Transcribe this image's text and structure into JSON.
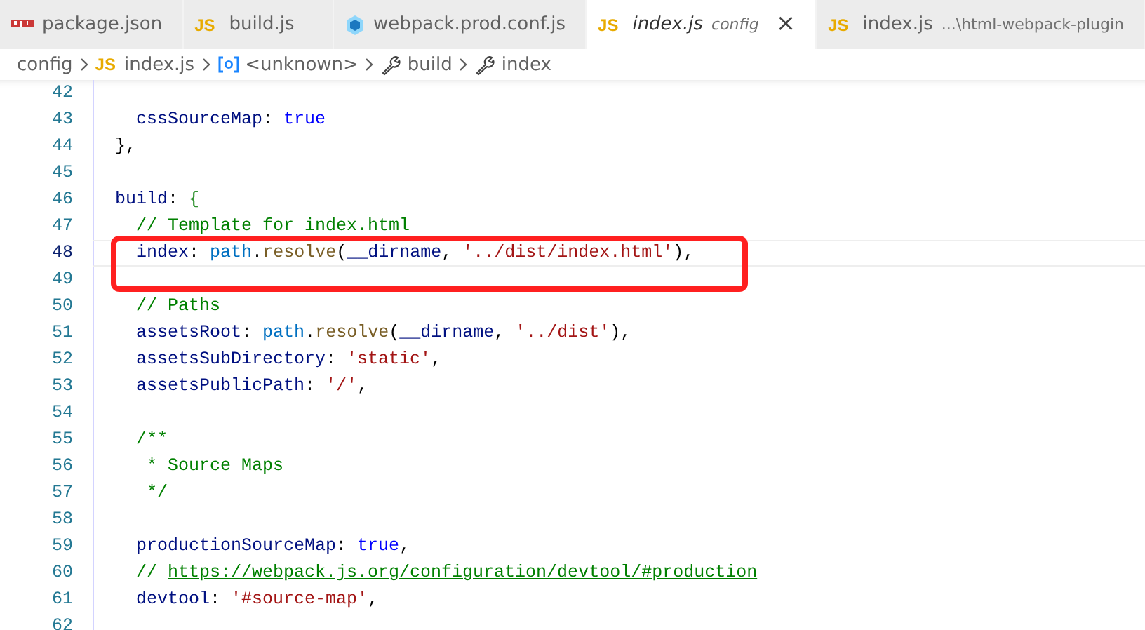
{
  "tabs": [
    {
      "kind": "npm",
      "label": "package.json",
      "selected": false
    },
    {
      "kind": "js",
      "icon_text": "JS",
      "label": "build.js",
      "selected": false
    },
    {
      "kind": "webpack",
      "label": "webpack.prod.conf.js",
      "selected": false
    },
    {
      "kind": "js",
      "icon_text": "JS",
      "label": "index.js",
      "description": "config",
      "close": "×",
      "selected": true
    },
    {
      "kind": "js",
      "icon_text": "JS",
      "label": "index.js",
      "description": "...\\html-webpack-plugin",
      "selected": false
    }
  ],
  "breadcrumbs": [
    {
      "label": "config"
    },
    {
      "kind": "js",
      "icon_text": "JS",
      "label": "index.js"
    },
    {
      "kind": "symbol",
      "label": "<unknown>"
    },
    {
      "kind": "wrench",
      "label": "build"
    },
    {
      "kind": "wrench",
      "label": "index"
    }
  ],
  "editor": {
    "lines": [
      {
        "number": "42",
        "current": false,
        "highlighted": false
      },
      {
        "number": "43",
        "current": false,
        "highlighted": false,
        "tokens": [
          {
            "kind": "prop",
            "text": "    cssSourceMap"
          },
          {
            "kind": "punct",
            "text": ": "
          },
          {
            "kind": "keyword",
            "text": "true"
          }
        ]
      },
      {
        "number": "44",
        "current": false,
        "highlighted": false,
        "tokens": [
          {
            "kind": "punct",
            "text": "  },"
          }
        ]
      },
      {
        "number": "45",
        "current": false,
        "highlighted": false
      },
      {
        "number": "46",
        "current": false,
        "highlighted": false,
        "tokens": [
          {
            "kind": "prop",
            "text": "  build"
          },
          {
            "kind": "punct",
            "text": ": "
          },
          {
            "kind": "bracket",
            "text": "{"
          }
        ]
      },
      {
        "number": "47",
        "current": false,
        "highlighted": false,
        "tokens": [
          {
            "kind": "comment",
            "text": "    // Template for index.html"
          }
        ]
      },
      {
        "number": "48",
        "current": true,
        "highlighted": true,
        "tokens": [
          {
            "kind": "prop",
            "text": "    index"
          },
          {
            "kind": "punct",
            "text": ": "
          },
          {
            "kind": "var",
            "text": "path"
          },
          {
            "kind": "punct",
            "text": "."
          },
          {
            "kind": "func",
            "text": "resolve"
          },
          {
            "kind": "punct",
            "text": "("
          },
          {
            "kind": "prop",
            "text": "__dirname"
          },
          {
            "kind": "punct",
            "text": ", "
          },
          {
            "kind": "string",
            "text": "'../dist/index.html'"
          },
          {
            "kind": "punct",
            "text": "),"
          }
        ]
      },
      {
        "number": "49",
        "current": false,
        "highlighted": false
      },
      {
        "number": "50",
        "current": false,
        "highlighted": false,
        "tokens": [
          {
            "kind": "comment",
            "text": "    // Paths"
          }
        ]
      },
      {
        "number": "51",
        "current": false,
        "highlighted": false,
        "tokens": [
          {
            "kind": "prop",
            "text": "    assetsRoot"
          },
          {
            "kind": "punct",
            "text": ": "
          },
          {
            "kind": "var",
            "text": "path"
          },
          {
            "kind": "punct",
            "text": "."
          },
          {
            "kind": "func",
            "text": "resolve"
          },
          {
            "kind": "punct",
            "text": "("
          },
          {
            "kind": "prop",
            "text": "__dirname"
          },
          {
            "kind": "punct",
            "text": ", "
          },
          {
            "kind": "string",
            "text": "'../dist'"
          },
          {
            "kind": "punct",
            "text": "),"
          }
        ]
      },
      {
        "number": "52",
        "current": false,
        "highlighted": false,
        "tokens": [
          {
            "kind": "prop",
            "text": "    assetsSubDirectory"
          },
          {
            "kind": "punct",
            "text": ": "
          },
          {
            "kind": "string",
            "text": "'static'"
          },
          {
            "kind": "punct",
            "text": ","
          }
        ]
      },
      {
        "number": "53",
        "current": false,
        "highlighted": false,
        "tokens": [
          {
            "kind": "prop",
            "text": "    assetsPublicPath"
          },
          {
            "kind": "punct",
            "text": ": "
          },
          {
            "kind": "string",
            "text": "'/'"
          },
          {
            "kind": "punct",
            "text": ","
          }
        ]
      },
      {
        "number": "54",
        "current": false,
        "highlighted": false
      },
      {
        "number": "55",
        "current": false,
        "highlighted": false,
        "tokens": [
          {
            "kind": "comment",
            "text": "    /**"
          }
        ]
      },
      {
        "number": "56",
        "current": false,
        "highlighted": false,
        "tokens": [
          {
            "kind": "comment",
            "text": "     * Source Maps"
          }
        ]
      },
      {
        "number": "57",
        "current": false,
        "highlighted": false,
        "tokens": [
          {
            "kind": "comment",
            "text": "     */"
          }
        ]
      },
      {
        "number": "58",
        "current": false,
        "highlighted": false
      },
      {
        "number": "59",
        "current": false,
        "highlighted": false,
        "tokens": [
          {
            "kind": "prop",
            "text": "    productionSourceMap"
          },
          {
            "kind": "punct",
            "text": ": "
          },
          {
            "kind": "keyword",
            "text": "true"
          },
          {
            "kind": "punct",
            "text": ","
          }
        ]
      },
      {
        "number": "60",
        "current": false,
        "highlighted": false,
        "tokens": [
          {
            "kind": "comment",
            "text": "    // "
          },
          {
            "kind": "link",
            "text": "https://webpack.js.org/configuration/devtool/#production"
          }
        ]
      },
      {
        "number": "61",
        "current": false,
        "highlighted": false,
        "tokens": [
          {
            "kind": "prop",
            "text": "    devtool"
          },
          {
            "kind": "punct",
            "text": ": "
          },
          {
            "kind": "string",
            "text": "'#source-map'"
          },
          {
            "kind": "punct",
            "text": ","
          }
        ]
      },
      {
        "number": "62",
        "current": false,
        "highlighted": false
      }
    ]
  }
}
